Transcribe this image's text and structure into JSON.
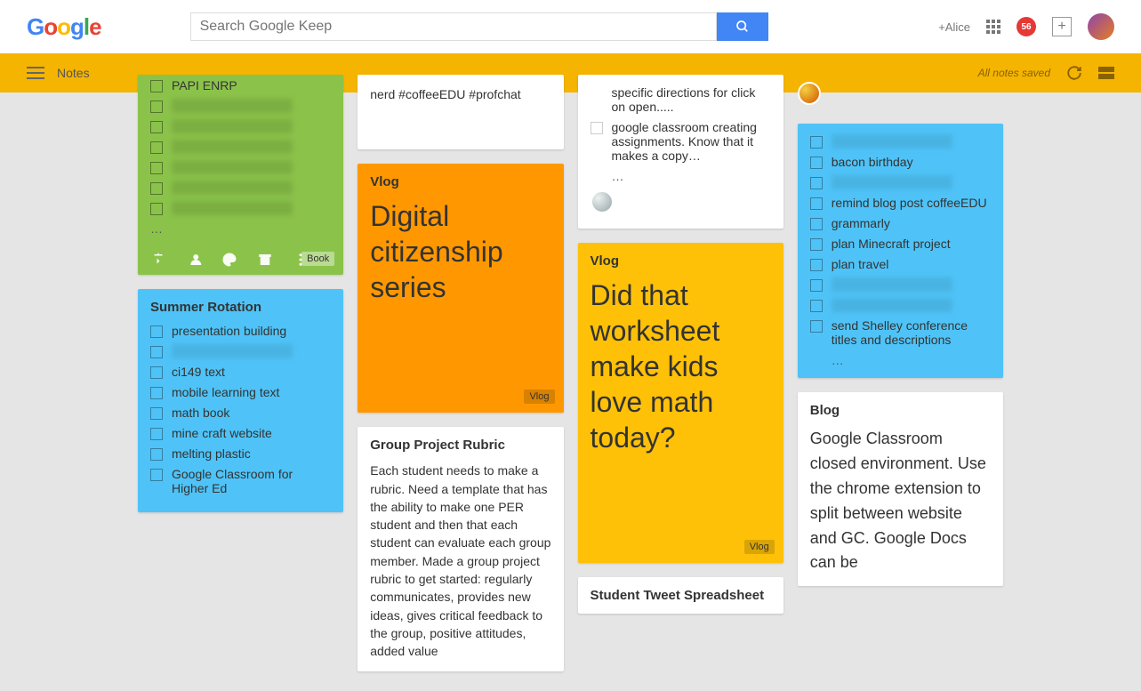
{
  "header": {
    "search_placeholder": "Search Google Keep",
    "user": "+Alice",
    "notif_count": "56"
  },
  "toolbar": {
    "section": "Notes",
    "saved": "All notes saved"
  },
  "col1": {
    "green_note": {
      "items": [
        "PAPI ENRP",
        "",
        "",
        "",
        "",
        "",
        ""
      ],
      "more": "…",
      "tag": "Book"
    },
    "summer": {
      "title": "Summer Rotation",
      "items": [
        "presentation building",
        "",
        "ci149 text",
        "mobile learning text",
        "math book",
        "mine craft website",
        "melting plastic",
        "Google Classroom for Higher Ed"
      ]
    }
  },
  "col2": {
    "snippet1": "nerd #coffeeEDU #profchat",
    "vlog": {
      "label": "Vlog",
      "title": "Digital citizenship series",
      "tag": "Vlog"
    },
    "rubric": {
      "title": "Group Project Rubric",
      "body": "Each student needs to make a rubric. Need a template that has the ability to make one PER student and then that each student can evaluate each group member. Made a group project rubric to get started: regularly communicates, provides new ideas, gives critical feedback to the group, positive attitudes, added value"
    }
  },
  "col3": {
    "snippet_top": {
      "line1": "specific directions for click on open.....",
      "line2": "google classroom creating assignments. Know that it makes a copy…",
      "more": "…"
    },
    "vlog": {
      "label": "Vlog",
      "title": "Did that worksheet make kids love math today?",
      "tag": "Vlog"
    },
    "tweet": {
      "title": "Student Tweet Spreadsheet"
    }
  },
  "col4": {
    "todo": {
      "items": [
        "",
        "bacon birthday",
        "",
        "remind blog post coffeeEDU",
        "grammarly",
        "plan Minecraft project",
        "plan travel",
        "",
        "",
        "send Shelley conference titles and descriptions"
      ],
      "more": "…"
    },
    "blog": {
      "title": "Blog",
      "body": "Google Classroom closed environment. Use the chrome extension to  split between website and GC. Google Docs can be"
    }
  }
}
